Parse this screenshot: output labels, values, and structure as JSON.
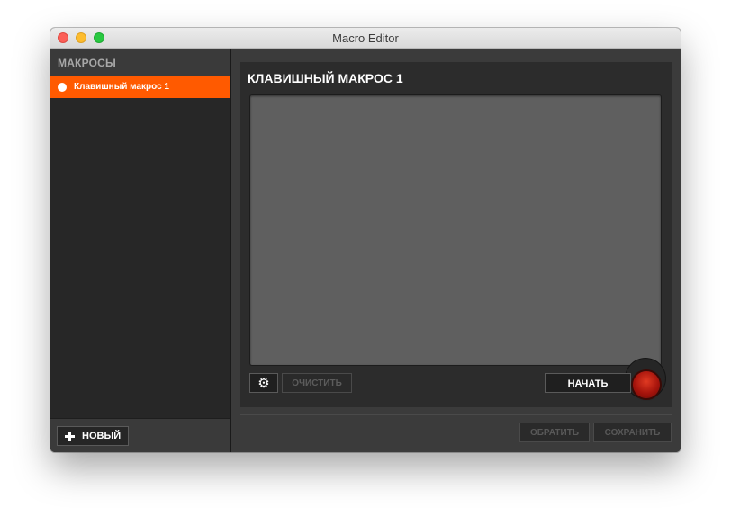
{
  "window": {
    "title": "Macro Editor"
  },
  "sidebar": {
    "header": "МАКРОСЫ",
    "items": [
      {
        "label": "Клавишный макрос 1",
        "selected": true
      }
    ],
    "new_button_label": "НОВЫЙ"
  },
  "editor": {
    "title": "КЛАВИШНЫЙ МАКРОС 1",
    "settings_icon": "gear-icon",
    "settings_glyph": "⚙",
    "clear_label": "ОЧИСТИТЬ",
    "start_label": "НАЧАТЬ",
    "record_icon": "record-icon"
  },
  "footer": {
    "undo_label": "ОБРАТИТЬ",
    "save_label": "СОХРАНИТЬ"
  },
  "colors": {
    "accent": "#ff5a00",
    "record": "#c41b10",
    "sidebar_bg": "#272727",
    "panel_bg": "#2c2c2c",
    "recording_area_bg": "#5f5f5f"
  }
}
